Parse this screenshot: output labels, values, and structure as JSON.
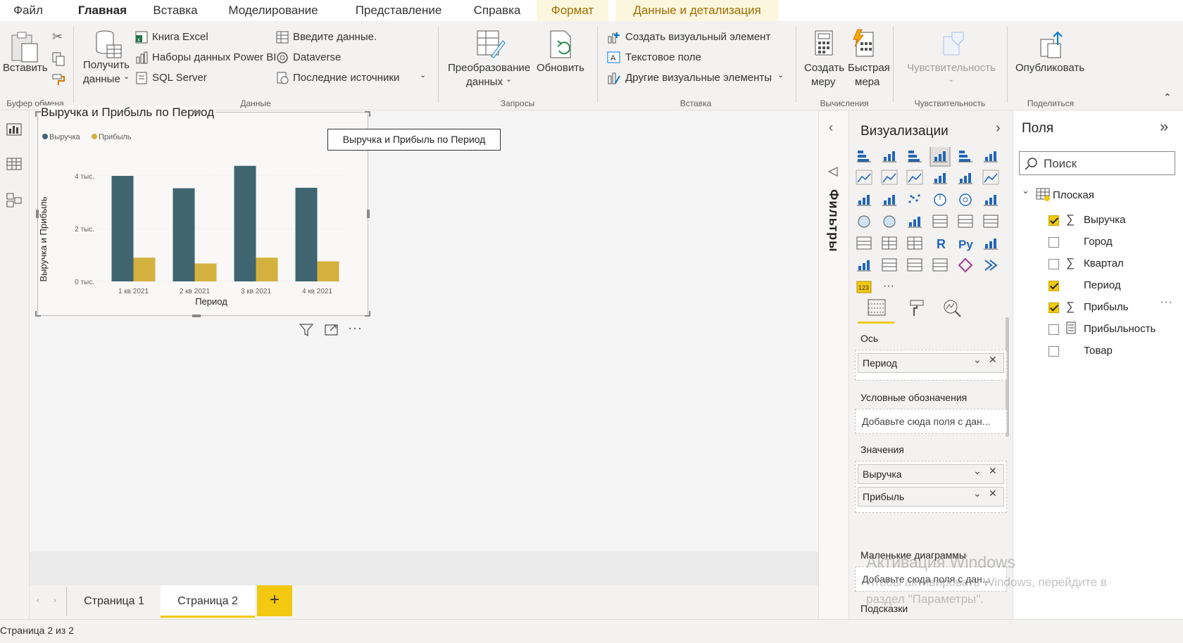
{
  "menu": {
    "file": "Файл",
    "home": "Главная",
    "insert": "Вставка",
    "modeling": "Моделирование",
    "view": "Представление",
    "help": "Справка",
    "format": "Формат",
    "data_drill": "Данные и детализация"
  },
  "ribbon": {
    "paste": "Вставить",
    "clipboard_group": "Буфер обмена",
    "get_data_1": "Получить",
    "get_data_2": "данные",
    "excel": "Книга Excel",
    "pbi_datasets": "Наборы данных Power BI",
    "sql": "SQL Server",
    "enter_data": "Введите данные.",
    "dataverse": "Dataverse",
    "recent_sources": "Последние источники",
    "data_group": "Данные",
    "transform_1": "Преобразование",
    "transform_2": "данных",
    "refresh": "Обновить",
    "queries_group": "Запросы",
    "new_visual": "Создать визуальный элемент",
    "text_box": "Текстовое поле",
    "more_visuals": "Другие визуальные элементы",
    "insert_group": "Вставка",
    "new_measure_1": "Создать",
    "new_measure_2": "меру",
    "quick_measure_1": "Быстрая",
    "quick_measure_2": "мера",
    "calc_group": "Вычисления",
    "sensitivity": "Чувствительность",
    "sensitivity_group": "Чувствительность",
    "publish": "Опубликовать",
    "share_group": "Поделиться"
  },
  "chart_data": {
    "type": "bar",
    "title": "Выручка и Прибыль по Период",
    "xlabel": "Период",
    "ylabel": "Выручка и Прибыль",
    "categories": [
      "1 кв 2021",
      "2 кв 2021",
      "3 кв 2021",
      "4 кв 2021"
    ],
    "series": [
      {
        "name": "Выручка",
        "color": "#3f6571",
        "values": [
          4000,
          3530,
          4380,
          3550
        ]
      },
      {
        "name": "Прибыль",
        "color": "#d4b13f",
        "values": [
          900,
          680,
          900,
          760
        ]
      }
    ],
    "yticks": [
      "0 тыс.",
      "2 тыс.",
      "4 тыс."
    ],
    "ylim": [
      0,
      4800
    ],
    "grid": true,
    "legend_position": "top-left"
  },
  "tooltip": "Выручка и Прибыль по Период",
  "tabs": {
    "page1": "Страница 1",
    "page2": "Страница 2",
    "add": "+"
  },
  "status": "Страница 2 из 2",
  "filters": {
    "label": "Фильтры"
  },
  "viz": {
    "title": "Визуализации",
    "axis_label": "Ось",
    "axis_value": "Период",
    "legend_label": "Условные обозначения",
    "legend_placeholder": "Добавьте сюда поля с дан...",
    "values_label": "Значения",
    "value1": "Выручка",
    "value2": "Прибыль",
    "small_multiples_label": "Маленькие диаграммы",
    "small_multiples_placeholder": "Добавьте сюда поля с дан...",
    "tooltips_label": "Подсказки"
  },
  "fields": {
    "title": "Поля",
    "search_placeholder": "Поиск",
    "table": "Плоская",
    "items": [
      {
        "label": "Выручка",
        "checked": true,
        "sigma": true
      },
      {
        "label": "Город",
        "checked": false,
        "sigma": false
      },
      {
        "label": "Квартал",
        "checked": false,
        "sigma": true
      },
      {
        "label": "Период",
        "checked": true,
        "sigma": false
      },
      {
        "label": "Прибыль",
        "checked": true,
        "sigma": true
      },
      {
        "label": "Прибыльность",
        "checked": false,
        "sigma": false
      },
      {
        "label": "Товар",
        "checked": false,
        "sigma": false
      }
    ]
  },
  "watermark": {
    "line1": "Активация Windows",
    "line2": "Чтобы активировать Windows, перейдите в",
    "line3": "раздел \"Параметры\"."
  }
}
